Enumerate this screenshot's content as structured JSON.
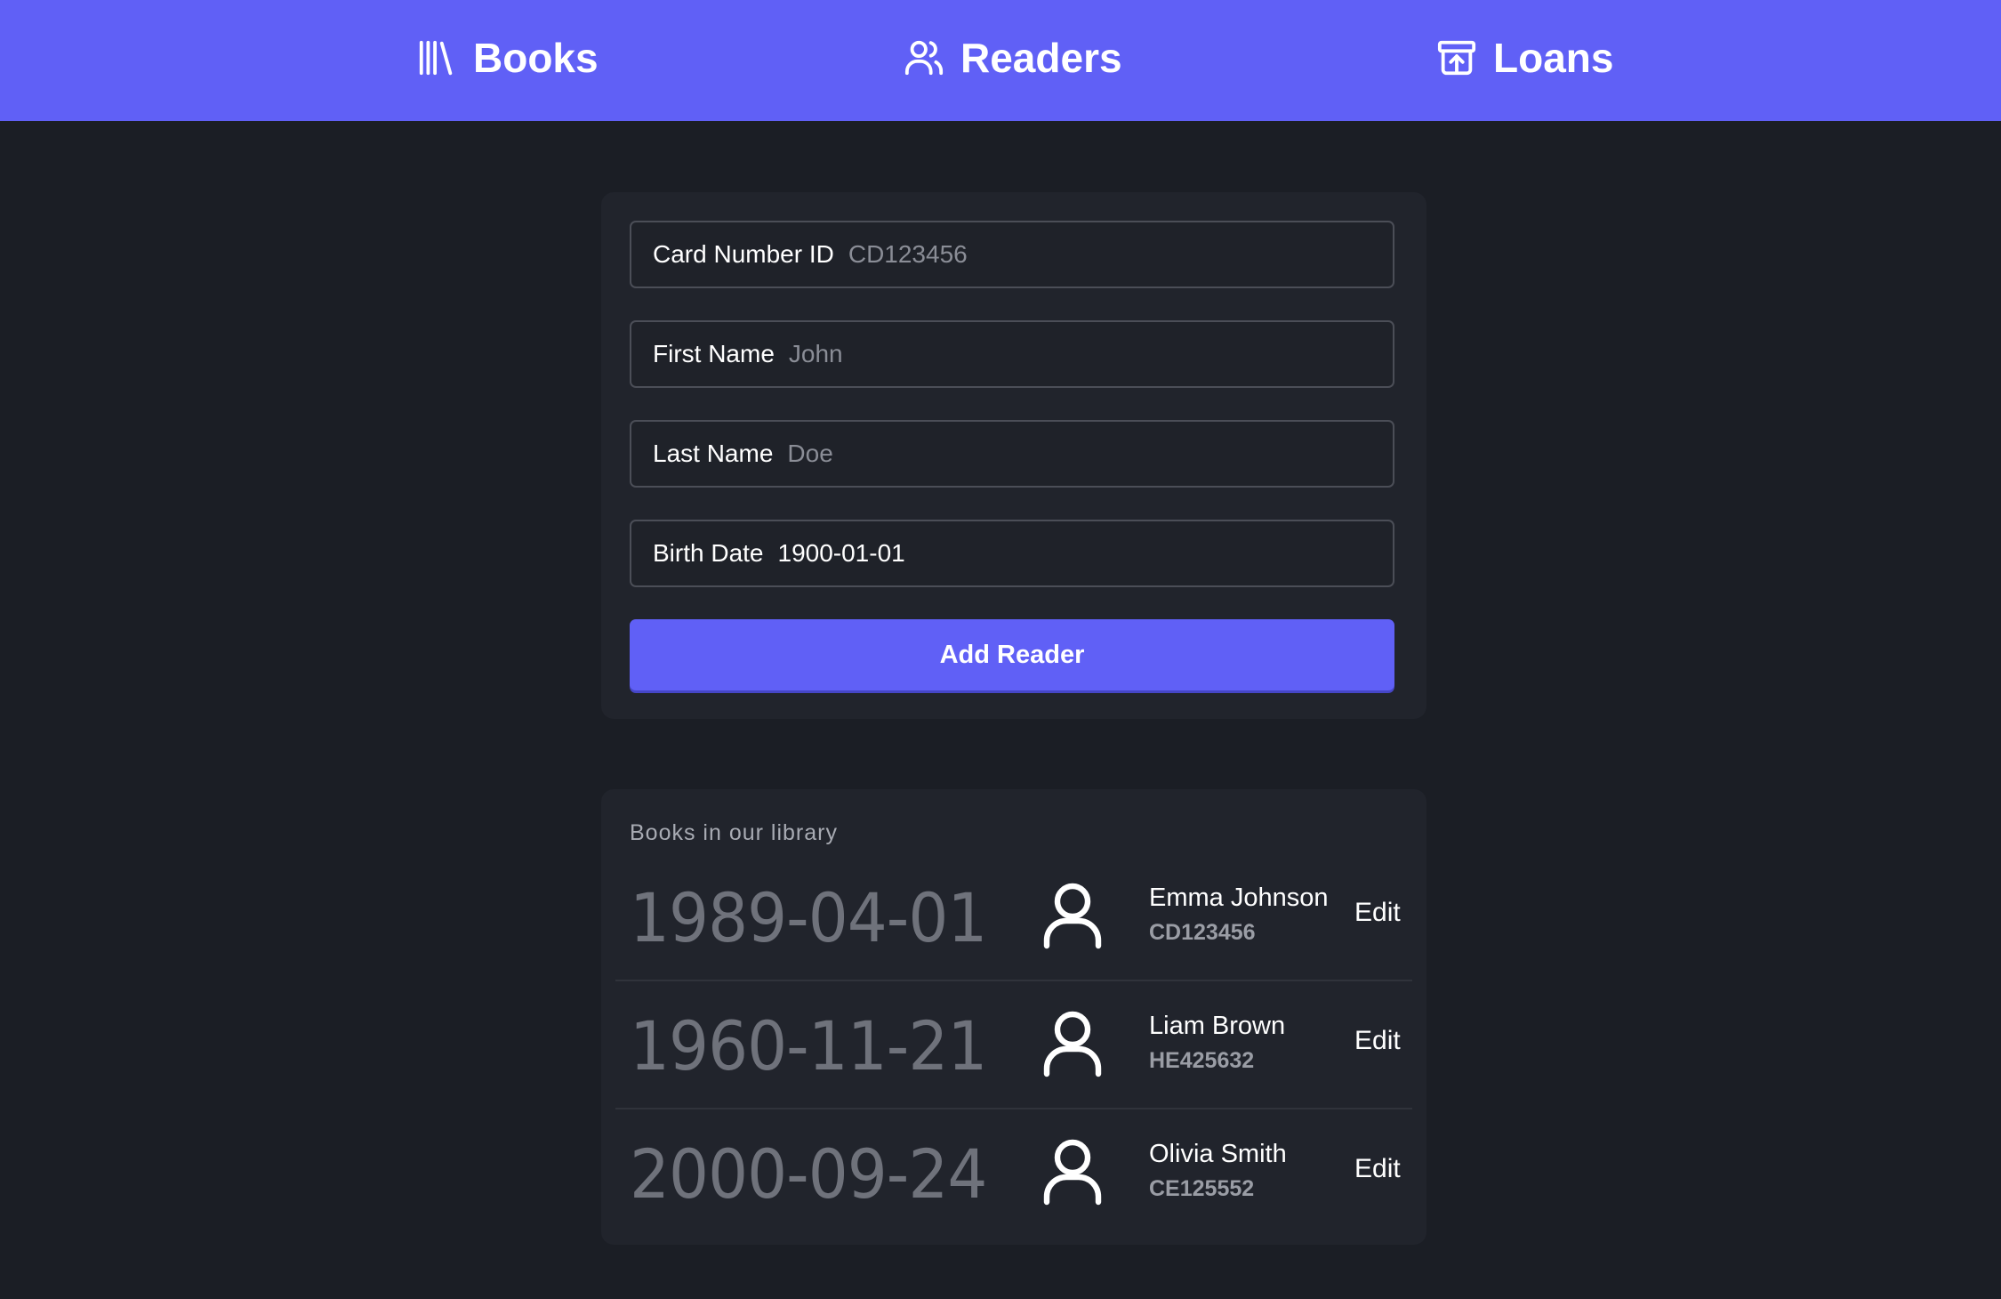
{
  "nav": {
    "items": [
      {
        "label": "Books",
        "icon": "books-icon"
      },
      {
        "label": "Readers",
        "icon": "users-icon"
      },
      {
        "label": "Loans",
        "icon": "archive-upload-icon"
      }
    ]
  },
  "form": {
    "card_number": {
      "label": "Card Number ID",
      "placeholder": "CD123456",
      "value": ""
    },
    "first_name": {
      "label": "First Name",
      "placeholder": "John",
      "value": ""
    },
    "last_name": {
      "label": "Last Name",
      "placeholder": "Doe",
      "value": ""
    },
    "birth_date": {
      "label": "Birth Date",
      "value": "1900-01-01"
    },
    "submit_label": "Add Reader"
  },
  "list": {
    "heading": "Books in our library",
    "edit_label": "Edit",
    "readers": [
      {
        "birth_date": "1989-04-01",
        "name": "Emma Johnson",
        "card_id": "CD123456",
        "icon": "user-icon"
      },
      {
        "birth_date": "1960-11-21",
        "name": "Liam Brown",
        "card_id": "HE425632",
        "icon": "user-icon"
      },
      {
        "birth_date": "2000-09-24",
        "name": "Olivia Smith",
        "card_id": "CE125552",
        "icon": "user-icon"
      }
    ]
  },
  "colors": {
    "accent": "#6060f6",
    "background": "#1b1e25",
    "card": "#21242c"
  }
}
